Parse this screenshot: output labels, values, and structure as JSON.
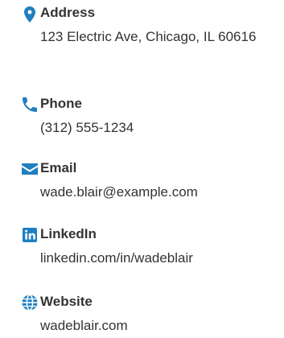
{
  "accent_color": "#1e7fc1",
  "contacts": [
    {
      "icon": "map-pin-icon",
      "label": "Address",
      "value": "123 Electric Ave, Chicago, IL 60616"
    },
    {
      "icon": "phone-icon",
      "label": "Phone",
      "value": "(312) 555-1234"
    },
    {
      "icon": "envelope-icon",
      "label": "Email",
      "value": "wade.blair@example.com"
    },
    {
      "icon": "linkedin-icon",
      "label": "LinkedIn",
      "value": "linkedin.com/in/wadeblair"
    },
    {
      "icon": "globe-icon",
      "label": "Website",
      "value": "wadeblair.com"
    }
  ]
}
